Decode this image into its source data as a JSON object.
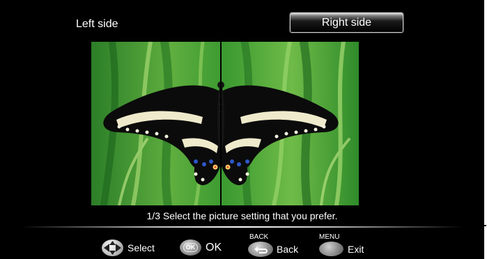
{
  "comparison": {
    "left_label": "Left side",
    "right_label": "Right side",
    "selected": "Right side"
  },
  "instruction": "1/3 Select the picture setting that you prefer.",
  "footer": {
    "select_label": "Select",
    "ok_button_text": "OK",
    "ok_label": "OK",
    "back_key": "BACK",
    "back_label": "Back",
    "menu_key": "MENU",
    "exit_label": "Exit"
  },
  "colors": {
    "background": "#000000",
    "text": "#ffffff",
    "highlight_border": "#cfcfcf"
  },
  "icons": {
    "select": "navigation-arrows-icon",
    "ok": "ok-button-icon",
    "back": "back-arrow-icon",
    "menu": "menu-button-icon"
  }
}
